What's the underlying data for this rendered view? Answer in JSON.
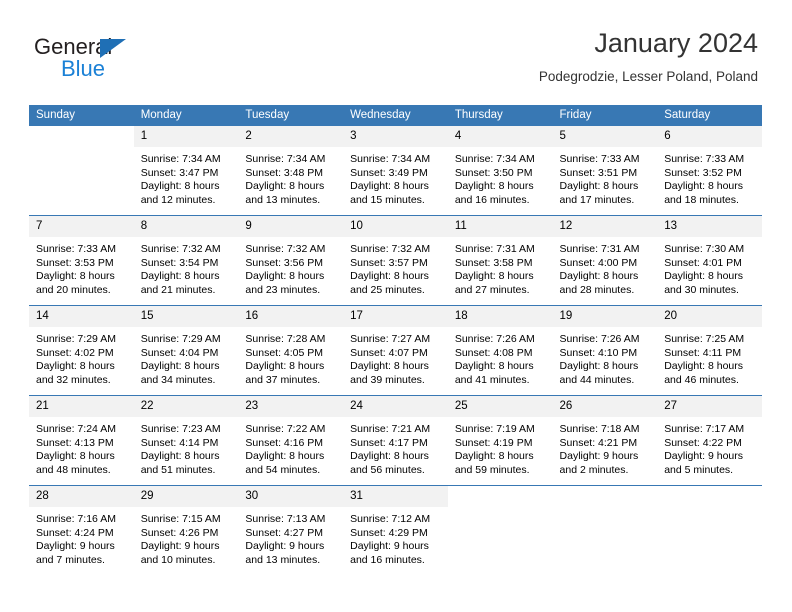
{
  "brand": {
    "name_top": "General",
    "name_bottom": "Blue",
    "triangle_color": "#1f6fb5",
    "blue_color": "#1b81d6"
  },
  "header": {
    "title": "January 2024",
    "subtitle": "Podegrodzie, Lesser Poland, Poland"
  },
  "theme": {
    "header_bg": "#3878b4",
    "daynum_bg": "#f2f2f2",
    "grid_line": "#3878b4"
  },
  "weekday_headers": [
    "Sunday",
    "Monday",
    "Tuesday",
    "Wednesday",
    "Thursday",
    "Friday",
    "Saturday"
  ],
  "labels": {
    "sunrise_prefix": "Sunrise:",
    "sunset_prefix": "Sunset:",
    "daylight_prefix": "Daylight:"
  },
  "weeks": [
    [
      {
        "day": "",
        "sunrise": "",
        "sunset": "",
        "daylight_line1": "",
        "daylight_line2": ""
      },
      {
        "day": "1",
        "sunrise": "Sunrise: 7:34 AM",
        "sunset": "Sunset: 3:47 PM",
        "daylight_line1": "Daylight: 8 hours",
        "daylight_line2": "and 12 minutes."
      },
      {
        "day": "2",
        "sunrise": "Sunrise: 7:34 AM",
        "sunset": "Sunset: 3:48 PM",
        "daylight_line1": "Daylight: 8 hours",
        "daylight_line2": "and 13 minutes."
      },
      {
        "day": "3",
        "sunrise": "Sunrise: 7:34 AM",
        "sunset": "Sunset: 3:49 PM",
        "daylight_line1": "Daylight: 8 hours",
        "daylight_line2": "and 15 minutes."
      },
      {
        "day": "4",
        "sunrise": "Sunrise: 7:34 AM",
        "sunset": "Sunset: 3:50 PM",
        "daylight_line1": "Daylight: 8 hours",
        "daylight_line2": "and 16 minutes."
      },
      {
        "day": "5",
        "sunrise": "Sunrise: 7:33 AM",
        "sunset": "Sunset: 3:51 PM",
        "daylight_line1": "Daylight: 8 hours",
        "daylight_line2": "and 17 minutes."
      },
      {
        "day": "6",
        "sunrise": "Sunrise: 7:33 AM",
        "sunset": "Sunset: 3:52 PM",
        "daylight_line1": "Daylight: 8 hours",
        "daylight_line2": "and 18 minutes."
      }
    ],
    [
      {
        "day": "7",
        "sunrise": "Sunrise: 7:33 AM",
        "sunset": "Sunset: 3:53 PM",
        "daylight_line1": "Daylight: 8 hours",
        "daylight_line2": "and 20 minutes."
      },
      {
        "day": "8",
        "sunrise": "Sunrise: 7:32 AM",
        "sunset": "Sunset: 3:54 PM",
        "daylight_line1": "Daylight: 8 hours",
        "daylight_line2": "and 21 minutes."
      },
      {
        "day": "9",
        "sunrise": "Sunrise: 7:32 AM",
        "sunset": "Sunset: 3:56 PM",
        "daylight_line1": "Daylight: 8 hours",
        "daylight_line2": "and 23 minutes."
      },
      {
        "day": "10",
        "sunrise": "Sunrise: 7:32 AM",
        "sunset": "Sunset: 3:57 PM",
        "daylight_line1": "Daylight: 8 hours",
        "daylight_line2": "and 25 minutes."
      },
      {
        "day": "11",
        "sunrise": "Sunrise: 7:31 AM",
        "sunset": "Sunset: 3:58 PM",
        "daylight_line1": "Daylight: 8 hours",
        "daylight_line2": "and 27 minutes."
      },
      {
        "day": "12",
        "sunrise": "Sunrise: 7:31 AM",
        "sunset": "Sunset: 4:00 PM",
        "daylight_line1": "Daylight: 8 hours",
        "daylight_line2": "and 28 minutes."
      },
      {
        "day": "13",
        "sunrise": "Sunrise: 7:30 AM",
        "sunset": "Sunset: 4:01 PM",
        "daylight_line1": "Daylight: 8 hours",
        "daylight_line2": "and 30 minutes."
      }
    ],
    [
      {
        "day": "14",
        "sunrise": "Sunrise: 7:29 AM",
        "sunset": "Sunset: 4:02 PM",
        "daylight_line1": "Daylight: 8 hours",
        "daylight_line2": "and 32 minutes."
      },
      {
        "day": "15",
        "sunrise": "Sunrise: 7:29 AM",
        "sunset": "Sunset: 4:04 PM",
        "daylight_line1": "Daylight: 8 hours",
        "daylight_line2": "and 34 minutes."
      },
      {
        "day": "16",
        "sunrise": "Sunrise: 7:28 AM",
        "sunset": "Sunset: 4:05 PM",
        "daylight_line1": "Daylight: 8 hours",
        "daylight_line2": "and 37 minutes."
      },
      {
        "day": "17",
        "sunrise": "Sunrise: 7:27 AM",
        "sunset": "Sunset: 4:07 PM",
        "daylight_line1": "Daylight: 8 hours",
        "daylight_line2": "and 39 minutes."
      },
      {
        "day": "18",
        "sunrise": "Sunrise: 7:26 AM",
        "sunset": "Sunset: 4:08 PM",
        "daylight_line1": "Daylight: 8 hours",
        "daylight_line2": "and 41 minutes."
      },
      {
        "day": "19",
        "sunrise": "Sunrise: 7:26 AM",
        "sunset": "Sunset: 4:10 PM",
        "daylight_line1": "Daylight: 8 hours",
        "daylight_line2": "and 44 minutes."
      },
      {
        "day": "20",
        "sunrise": "Sunrise: 7:25 AM",
        "sunset": "Sunset: 4:11 PM",
        "daylight_line1": "Daylight: 8 hours",
        "daylight_line2": "and 46 minutes."
      }
    ],
    [
      {
        "day": "21",
        "sunrise": "Sunrise: 7:24 AM",
        "sunset": "Sunset: 4:13 PM",
        "daylight_line1": "Daylight: 8 hours",
        "daylight_line2": "and 48 minutes."
      },
      {
        "day": "22",
        "sunrise": "Sunrise: 7:23 AM",
        "sunset": "Sunset: 4:14 PM",
        "daylight_line1": "Daylight: 8 hours",
        "daylight_line2": "and 51 minutes."
      },
      {
        "day": "23",
        "sunrise": "Sunrise: 7:22 AM",
        "sunset": "Sunset: 4:16 PM",
        "daylight_line1": "Daylight: 8 hours",
        "daylight_line2": "and 54 minutes."
      },
      {
        "day": "24",
        "sunrise": "Sunrise: 7:21 AM",
        "sunset": "Sunset: 4:17 PM",
        "daylight_line1": "Daylight: 8 hours",
        "daylight_line2": "and 56 minutes."
      },
      {
        "day": "25",
        "sunrise": "Sunrise: 7:19 AM",
        "sunset": "Sunset: 4:19 PM",
        "daylight_line1": "Daylight: 8 hours",
        "daylight_line2": "and 59 minutes."
      },
      {
        "day": "26",
        "sunrise": "Sunrise: 7:18 AM",
        "sunset": "Sunset: 4:21 PM",
        "daylight_line1": "Daylight: 9 hours",
        "daylight_line2": "and 2 minutes."
      },
      {
        "day": "27",
        "sunrise": "Sunrise: 7:17 AM",
        "sunset": "Sunset: 4:22 PM",
        "daylight_line1": "Daylight: 9 hours",
        "daylight_line2": "and 5 minutes."
      }
    ],
    [
      {
        "day": "28",
        "sunrise": "Sunrise: 7:16 AM",
        "sunset": "Sunset: 4:24 PM",
        "daylight_line1": "Daylight: 9 hours",
        "daylight_line2": "and 7 minutes."
      },
      {
        "day": "29",
        "sunrise": "Sunrise: 7:15 AM",
        "sunset": "Sunset: 4:26 PM",
        "daylight_line1": "Daylight: 9 hours",
        "daylight_line2": "and 10 minutes."
      },
      {
        "day": "30",
        "sunrise": "Sunrise: 7:13 AM",
        "sunset": "Sunset: 4:27 PM",
        "daylight_line1": "Daylight: 9 hours",
        "daylight_line2": "and 13 minutes."
      },
      {
        "day": "31",
        "sunrise": "Sunrise: 7:12 AM",
        "sunset": "Sunset: 4:29 PM",
        "daylight_line1": "Daylight: 9 hours",
        "daylight_line2": "and 16 minutes."
      },
      {
        "day": "",
        "sunrise": "",
        "sunset": "",
        "daylight_line1": "",
        "daylight_line2": ""
      },
      {
        "day": "",
        "sunrise": "",
        "sunset": "",
        "daylight_line1": "",
        "daylight_line2": ""
      },
      {
        "day": "",
        "sunrise": "",
        "sunset": "",
        "daylight_line1": "",
        "daylight_line2": ""
      }
    ]
  ]
}
